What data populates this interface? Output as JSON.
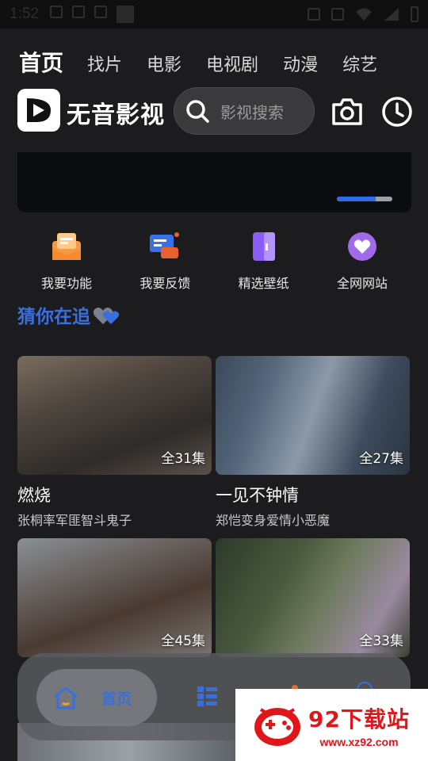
{
  "status_bar": {
    "time": "1:52"
  },
  "tabs": [
    {
      "label": "首页",
      "active": true
    },
    {
      "label": "找片",
      "active": false
    },
    {
      "label": "电影",
      "active": false
    },
    {
      "label": "电视剧",
      "active": false
    },
    {
      "label": "动漫",
      "active": false
    },
    {
      "label": "综艺",
      "active": false
    }
  ],
  "header": {
    "app_name": "无音影视",
    "search_placeholder": "影视搜索",
    "icons": [
      "search-icon",
      "camera-icon",
      "clock-icon"
    ]
  },
  "banner": {
    "page_progress": 0.7,
    "active_color": "#2d6fe8"
  },
  "shortcuts": [
    {
      "label": "我要功能",
      "icon": "mailbox-icon",
      "color": "#f29a45"
    },
    {
      "label": "我要反馈",
      "icon": "feedback-icon",
      "color": "#3a72e6"
    },
    {
      "label": "精选壁纸",
      "icon": "wallpaper-icon",
      "color": "#8b5cf6"
    },
    {
      "label": "全网网站",
      "icon": "heart-bubble-icon",
      "color": "#a06ae8"
    }
  ],
  "section": {
    "title": "猜你在追",
    "accent": "#3b6fe0"
  },
  "cards": [
    {
      "title": "燃烧",
      "subtitle": "张桐率军匪智斗鬼子",
      "episodes": "全31集"
    },
    {
      "title": "一见不钟情",
      "subtitle": "郑恺变身爱情小恶魔",
      "episodes": "全27集"
    },
    {
      "title": "",
      "subtitle": "",
      "episodes": "全45集"
    },
    {
      "title": "",
      "subtitle": "",
      "episodes": "全33集"
    }
  ],
  "bottom_nav": {
    "home_label": "首页",
    "icons": [
      "home-icon",
      "list-icon",
      "discover-icon",
      "profile-icon"
    ]
  },
  "watermark": {
    "big": "92下载站",
    "small": "www.xz92.com"
  }
}
